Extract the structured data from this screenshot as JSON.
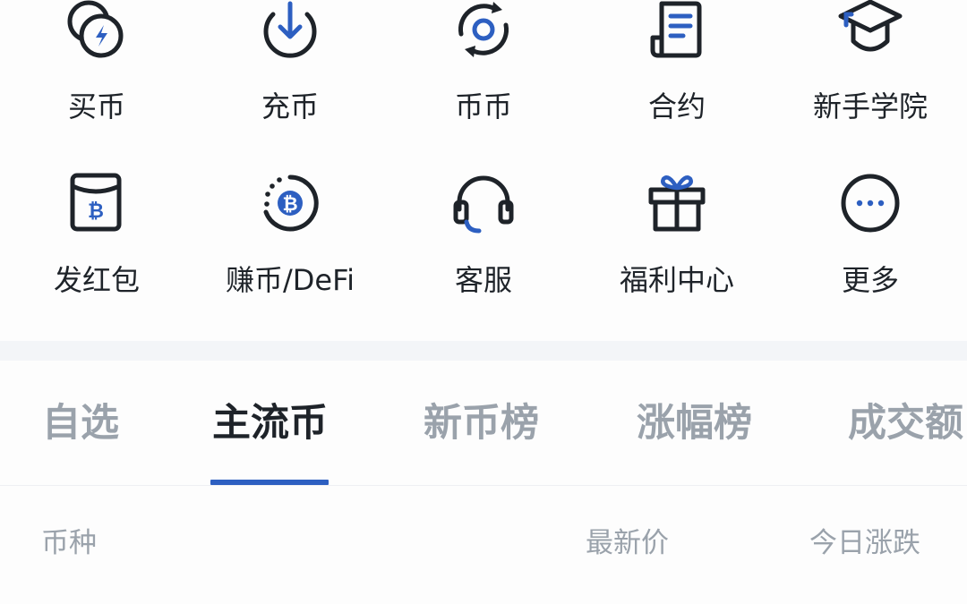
{
  "quick_actions": {
    "row1": [
      {
        "label": "买币",
        "icon": "buy-coin-icon"
      },
      {
        "label": "充币",
        "icon": "deposit-icon"
      },
      {
        "label": "币币",
        "icon": "spot-trade-icon"
      },
      {
        "label": "合约",
        "icon": "contract-icon"
      },
      {
        "label": "新手学院",
        "icon": "academy-icon"
      }
    ],
    "row2": [
      {
        "label": "发红包",
        "icon": "red-packet-icon"
      },
      {
        "label": "赚币/DeFi",
        "icon": "earn-icon"
      },
      {
        "label": "客服",
        "icon": "support-icon"
      },
      {
        "label": "福利中心",
        "icon": "gift-icon"
      },
      {
        "label": "更多",
        "icon": "more-icon"
      }
    ]
  },
  "market_tabs": [
    "自选",
    "主流币",
    "新币榜",
    "涨幅榜",
    "成交额"
  ],
  "active_tab": "主流币",
  "columns": {
    "coin": "币种",
    "price": "最新价",
    "change": "今日涨跌"
  },
  "colors": {
    "accent": "#2d5fc1",
    "text_primary": "#1e2329",
    "text_secondary": "#9aa2ab"
  }
}
